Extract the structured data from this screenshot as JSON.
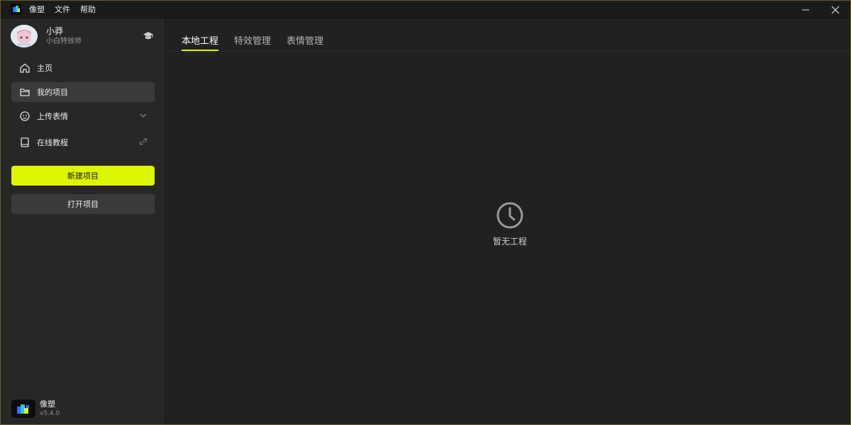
{
  "titlebar": {
    "menu": [
      "像塑",
      "文件",
      "帮助"
    ]
  },
  "user": {
    "name": "小莽",
    "title": "小白特效师"
  },
  "sidebar": {
    "items": [
      {
        "label": "主页",
        "icon": "home-icon"
      },
      {
        "label": "我的项目",
        "icon": "folder-icon",
        "active": true
      },
      {
        "label": "上传表情",
        "icon": "emoji-icon",
        "tail": "chevron-down-icon"
      },
      {
        "label": "在线教程",
        "icon": "book-icon",
        "tail": "link-icon"
      }
    ],
    "new_project": "新建项目",
    "open_project": "打开项目"
  },
  "brand": {
    "name": "像塑",
    "version": "v5.4.0"
  },
  "main": {
    "tabs": [
      {
        "label": "本地工程",
        "active": true
      },
      {
        "label": "特效管理"
      },
      {
        "label": "表情管理"
      }
    ],
    "empty_text": "暂无工程"
  },
  "colors": {
    "accent": "#dcf500",
    "sidebar_bg": "#272727",
    "main_bg": "#212121",
    "active_item": "#3a3a3a"
  }
}
